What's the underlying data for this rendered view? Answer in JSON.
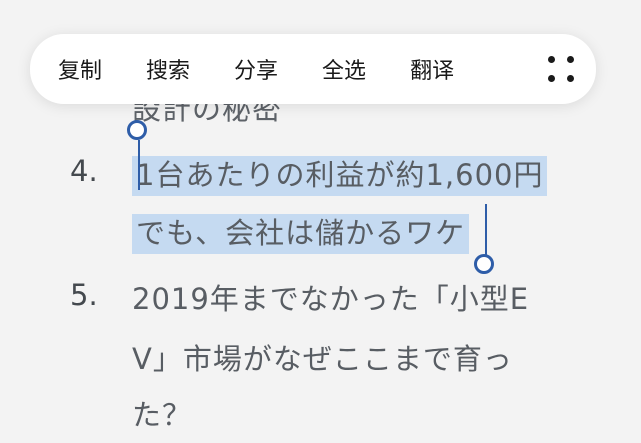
{
  "context_menu": {
    "items": [
      {
        "label": "复制"
      },
      {
        "label": "搜索"
      },
      {
        "label": "分享"
      },
      {
        "label": "全选"
      },
      {
        "label": "翻译"
      }
    ],
    "more_icon": "more-grid-icon"
  },
  "content": {
    "partial_line": "設計の秘密",
    "items": [
      {
        "number": "4.",
        "lines": [
          "1台あたりの利益が約1,600円",
          "でも、会社は儲かるワケ"
        ],
        "selected": true
      },
      {
        "number": "5.",
        "lines": [
          "2019年までなかった「小型E",
          "V」市場がなぜここまで育っ",
          "た？"
        ],
        "selected": false
      }
    ]
  },
  "colors": {
    "selection_highlight": "#c5daf1",
    "handle": "#2e5da8",
    "text": "#585d63"
  }
}
